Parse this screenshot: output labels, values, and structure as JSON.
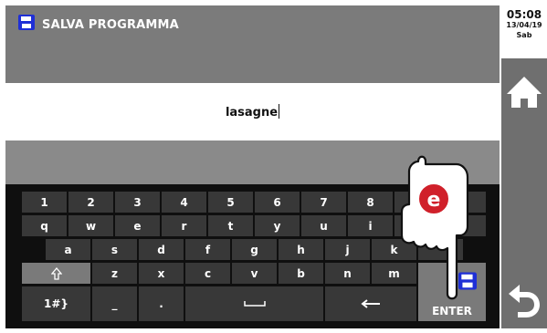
{
  "header": {
    "title": "SALVA PROGRAMMA",
    "icon": "save-icon"
  },
  "input": {
    "value": "lasagne"
  },
  "clock": {
    "time": "05:08",
    "date": "13/04/19",
    "day": "Sab"
  },
  "keyboard": {
    "row1": [
      "1",
      "2",
      "3",
      "4",
      "5",
      "6",
      "7",
      "8"
    ],
    "row2": [
      "q",
      "w",
      "e",
      "r",
      "t",
      "y",
      "u",
      "i"
    ],
    "row3": [
      "a",
      "s",
      "d",
      "f",
      "g",
      "h",
      "j",
      "k"
    ],
    "row4": [
      "z",
      "x",
      "c",
      "v",
      "b",
      "n",
      "m"
    ],
    "shift_icon": "shift-icon",
    "symbols_label": "1#}",
    "underscore_label": "_",
    "dot_label": ".",
    "space_icon": "space-icon",
    "backspace_icon": "backspace-arrow-icon",
    "enter_label": "ENTER"
  },
  "side": {
    "home_icon": "home-icon",
    "back_icon": "back-arrow-icon"
  },
  "callout": {
    "letter": "e",
    "color": "#d0202a"
  }
}
